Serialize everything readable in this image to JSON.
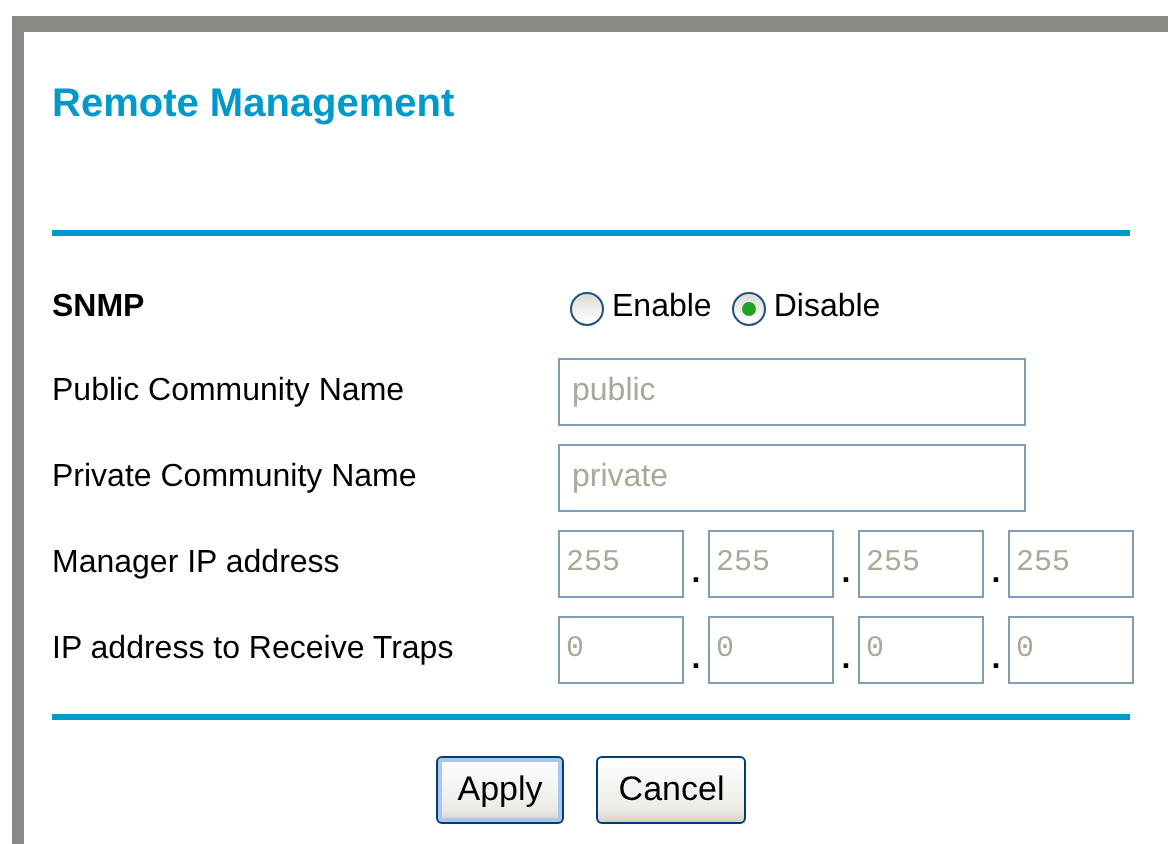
{
  "title": "Remote Management",
  "snmp": {
    "label": "SNMP",
    "options": [
      {
        "label": "Enable",
        "selected": false
      },
      {
        "label": "Disable",
        "selected": true
      }
    ]
  },
  "fields": [
    {
      "label": "Public Community Name",
      "value": "public",
      "disabled": true
    },
    {
      "label": "Private Community Name",
      "value": "private",
      "disabled": true
    }
  ],
  "ip_rows": [
    {
      "label": "Manager IP address",
      "separator": ".",
      "octets": [
        "255",
        "255",
        "255",
        "255"
      ],
      "disabled": true
    },
    {
      "label": "IP address to Receive Traps",
      "separator": ".",
      "octets": [
        "0",
        "0",
        "0",
        "0"
      ],
      "disabled": true
    }
  ],
  "buttons": [
    {
      "label": "Apply",
      "focused": true
    },
    {
      "label": "Cancel",
      "focused": false
    }
  ]
}
